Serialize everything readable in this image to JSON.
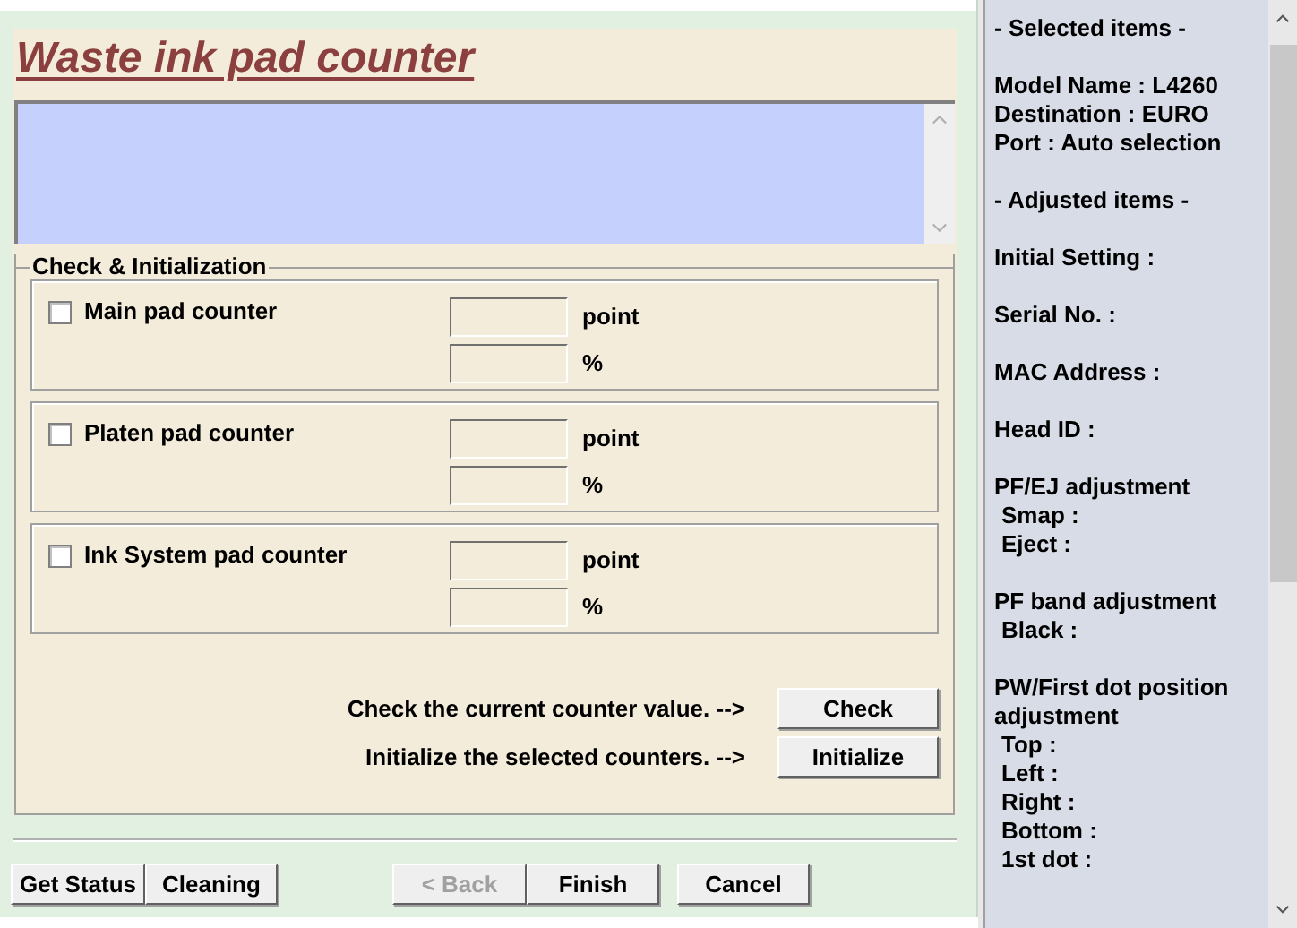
{
  "title": "Waste ink pad counter",
  "group": {
    "label": "Check & Initialization",
    "counters": [
      {
        "label": "Main pad counter",
        "checked": false,
        "fields": [
          {
            "unit": "point"
          },
          {
            "unit": "%"
          }
        ]
      },
      {
        "label": "Platen pad counter",
        "checked": false,
        "fields": [
          {
            "unit": "point"
          },
          {
            "unit": "%"
          }
        ]
      },
      {
        "label": "Ink System pad counter",
        "checked": false,
        "fields": [
          {
            "unit": "point"
          },
          {
            "unit": "%"
          }
        ]
      }
    ],
    "actions": [
      {
        "text": "Check the current counter value. -->",
        "button": "Check"
      },
      {
        "text": "Initialize the selected counters. -->",
        "button": "Initialize"
      }
    ]
  },
  "footer_buttons": [
    {
      "label": "Get Status",
      "disabled": false
    },
    {
      "label": "Cleaning",
      "disabled": false
    },
    {
      "label": "< Back",
      "disabled": true
    },
    {
      "label": "Finish",
      "disabled": false
    },
    {
      "label": "Cancel",
      "disabled": false
    }
  ],
  "info_panel": {
    "sections": [
      {
        "lines": [
          {
            "text": "- Selected items -",
            "indent": false
          }
        ]
      },
      {
        "lines": [
          {
            "text": "Model Name : L4260",
            "indent": false
          },
          {
            "text": "Destination : EURO",
            "indent": false
          },
          {
            "text": "Port : Auto selection",
            "indent": false
          }
        ]
      },
      {
        "lines": [
          {
            "text": "- Adjusted items -",
            "indent": false
          }
        ]
      },
      {
        "lines": [
          {
            "text": "Initial Setting :",
            "indent": false
          }
        ]
      },
      {
        "lines": [
          {
            "text": "Serial No. :",
            "indent": false
          }
        ]
      },
      {
        "lines": [
          {
            "text": "MAC Address :",
            "indent": false
          }
        ]
      },
      {
        "lines": [
          {
            "text": "Head ID :",
            "indent": false
          }
        ]
      },
      {
        "lines": [
          {
            "text": "PF/EJ adjustment",
            "indent": false
          },
          {
            "text": "Smap :",
            "indent": true
          },
          {
            "text": "Eject :",
            "indent": true
          }
        ]
      },
      {
        "lines": [
          {
            "text": "PF band adjustment",
            "indent": false
          },
          {
            "text": "Black :",
            "indent": true
          }
        ]
      },
      {
        "lines": [
          {
            "text": "PW/First dot position adjustment",
            "indent": false
          },
          {
            "text": "Top :",
            "indent": true
          },
          {
            "text": "Left :",
            "indent": true
          },
          {
            "text": "Right :",
            "indent": true
          },
          {
            "text": "Bottom :",
            "indent": true
          },
          {
            "text": "1st dot :",
            "indent": true
          }
        ]
      }
    ]
  }
}
